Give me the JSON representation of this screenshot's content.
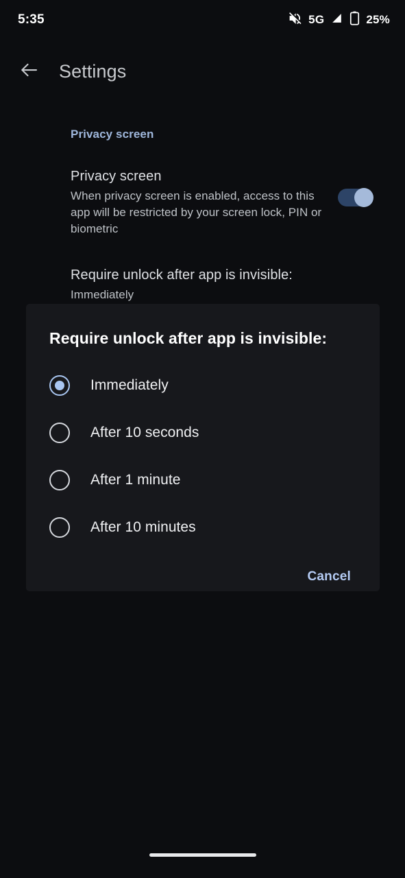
{
  "status_bar": {
    "clock": "5:35",
    "network_label": "5G",
    "battery_percent": "25%",
    "icons": {
      "mute": "volume-off-icon",
      "signal": "signal-cellular-icon",
      "battery": "battery-icon"
    }
  },
  "app_bar": {
    "back_icon": "back-arrow-icon",
    "title": "Settings"
  },
  "settings": {
    "category_header": "Privacy screen",
    "preferences": [
      {
        "title": "Privacy screen",
        "summary": "When privacy screen is enabled, access to this app will be restricted by your screen lock, PIN or biometric",
        "switch_on": true
      },
      {
        "title": "Require unlock after app is invisible:",
        "summary": "Immediately"
      }
    ]
  },
  "dialog": {
    "title": "Require unlock after app is invisible:",
    "options": [
      {
        "label": "Immediately",
        "selected": true
      },
      {
        "label": "After 10 seconds",
        "selected": false
      },
      {
        "label": "After 1 minute",
        "selected": false
      },
      {
        "label": "After 10 minutes",
        "selected": false
      }
    ],
    "cancel_label": "Cancel"
  },
  "nav_bar": {
    "home_indicator": "home-indicator"
  },
  "colors": {
    "page_background": "#0c0d10",
    "dialog_background": "#17181c",
    "accent": "#a9c6f1",
    "category_header": "#9fb7dc",
    "switch_track_on": "#2d4467",
    "switch_thumb_on": "#a5bada"
  }
}
